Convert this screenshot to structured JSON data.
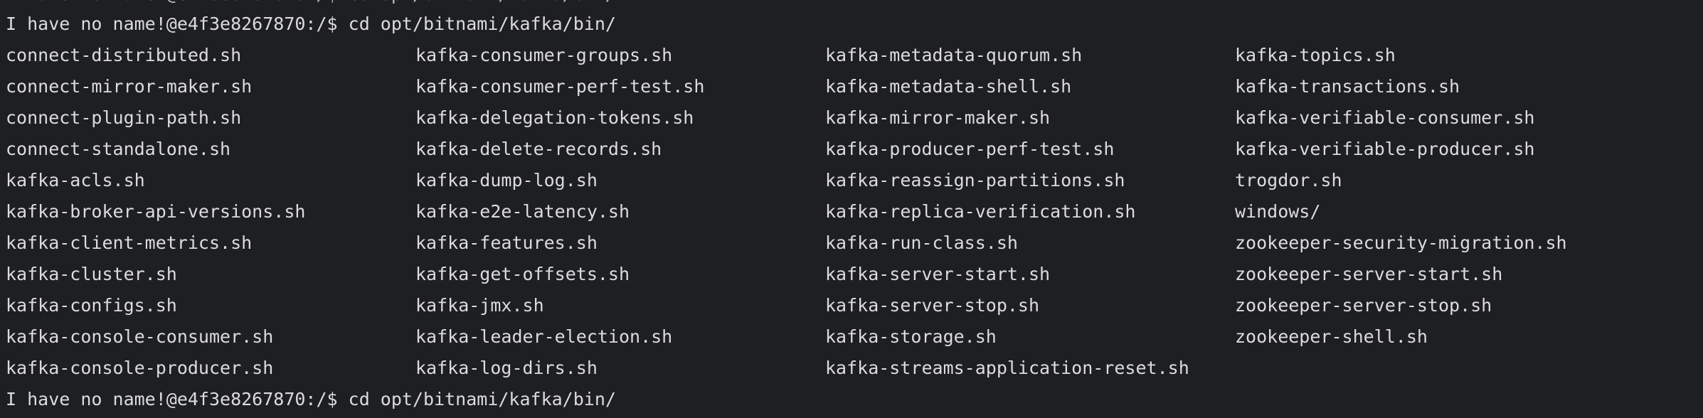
{
  "terminal": {
    "partial_top_line": "I have no name!@e4f3e8267870:/$ cd opt/bitnami/kafka/bin/",
    "prompt": "I have no name!@e4f3e8267870:/$",
    "command": "cd opt/bitnami/kafka/bin/",
    "listing": {
      "columns": [
        [
          "connect-distributed.sh",
          "connect-mirror-maker.sh",
          "connect-plugin-path.sh",
          "connect-standalone.sh",
          "kafka-acls.sh",
          "kafka-broker-api-versions.sh",
          "kafka-client-metrics.sh",
          "kafka-cluster.sh",
          "kafka-configs.sh",
          "kafka-console-consumer.sh",
          "kafka-console-producer.sh"
        ],
        [
          "kafka-consumer-groups.sh",
          "kafka-consumer-perf-test.sh",
          "kafka-delegation-tokens.sh",
          "kafka-delete-records.sh",
          "kafka-dump-log.sh",
          "kafka-e2e-latency.sh",
          "kafka-features.sh",
          "kafka-get-offsets.sh",
          "kafka-jmx.sh",
          "kafka-leader-election.sh",
          "kafka-log-dirs.sh"
        ],
        [
          "kafka-metadata-quorum.sh",
          "kafka-metadata-shell.sh",
          "kafka-mirror-maker.sh",
          "kafka-producer-perf-test.sh",
          "kafka-reassign-partitions.sh",
          "kafka-replica-verification.sh",
          "kafka-run-class.sh",
          "kafka-server-start.sh",
          "kafka-server-stop.sh",
          "kafka-storage.sh",
          "kafka-streams-application-reset.sh"
        ],
        [
          "kafka-topics.sh",
          "kafka-transactions.sh",
          "kafka-verifiable-consumer.sh",
          "kafka-verifiable-producer.sh",
          "trogdor.sh",
          "windows/",
          "zookeeper-security-migration.sh",
          "zookeeper-server-start.sh",
          "zookeeper-server-stop.sh",
          "zookeeper-shell.sh",
          ""
        ]
      ]
    }
  },
  "colors": {
    "background": "#1e1f22",
    "text": "#dcdcdc"
  }
}
